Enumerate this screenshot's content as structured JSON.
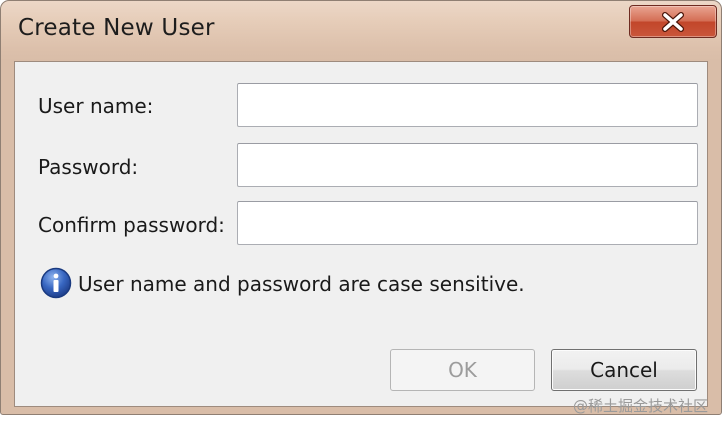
{
  "window": {
    "title": "Create New User"
  },
  "form": {
    "username_label": "User name:",
    "username_value": "",
    "password_label": "Password:",
    "password_value": "",
    "confirm_label": "Confirm password:",
    "confirm_value": ""
  },
  "info": {
    "icon": "info-icon",
    "text": "User name and password are case sensitive."
  },
  "buttons": {
    "ok_label": "OK",
    "ok_enabled": false,
    "cancel_label": "Cancel"
  },
  "watermark": {
    "text": "@稀土掘金技术社区"
  },
  "colors": {
    "title_bar": "#e6cdb9",
    "close_button": "#c9563b",
    "client_background": "#f0f0f0",
    "info_icon_blue": "#2a5db0"
  }
}
